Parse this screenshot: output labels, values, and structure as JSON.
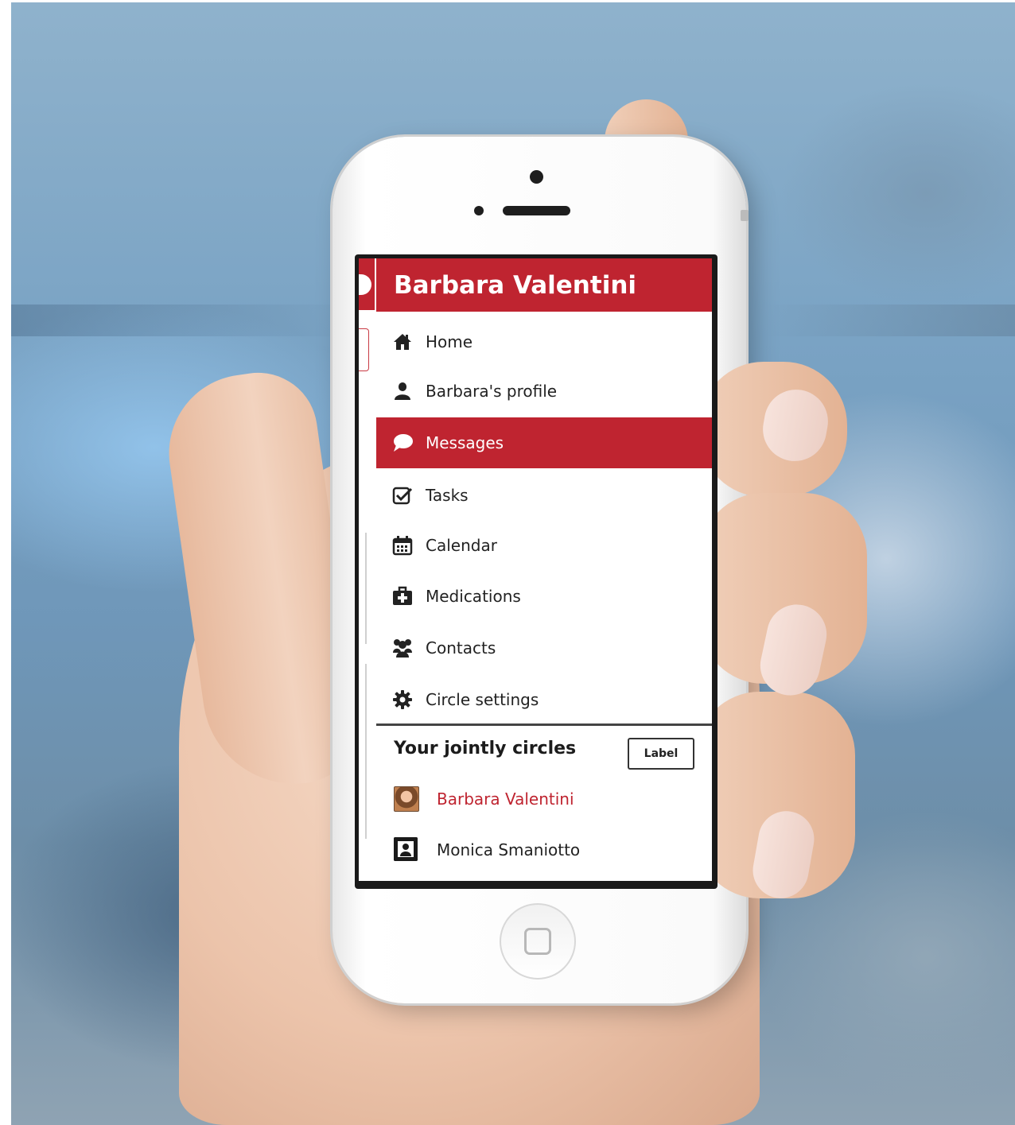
{
  "app": {
    "header_title": "Barbara Valentini",
    "accent_color": "#bf2430"
  },
  "menu": {
    "items": [
      {
        "label": "Home",
        "icon": "home-icon",
        "active": false
      },
      {
        "label": "Barbara's profile",
        "icon": "user-icon",
        "active": false
      },
      {
        "label": "Messages",
        "icon": "speech-bubble-icon",
        "active": true
      },
      {
        "label": "Tasks",
        "icon": "checkbox-icon",
        "active": false
      },
      {
        "label": "Calendar",
        "icon": "calendar-icon",
        "active": false
      },
      {
        "label": "Medications",
        "icon": "medical-kit-icon",
        "active": false
      },
      {
        "label": "Contacts",
        "icon": "group-icon",
        "active": false
      },
      {
        "label": "Circle settings",
        "icon": "gear-icon",
        "active": false
      }
    ]
  },
  "circles": {
    "title": "Your jointly circles",
    "label_button": "Label",
    "items": [
      {
        "name": "Barbara Valentini",
        "avatar": "photo-avatar",
        "highlight_color": "#bf2430"
      },
      {
        "name": "Monica Smaniotto",
        "avatar": "generic-avatar",
        "highlight_color": "#222222"
      }
    ]
  }
}
